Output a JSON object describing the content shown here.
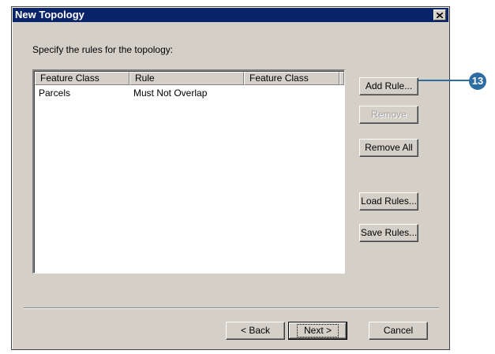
{
  "window": {
    "title": "New Topology"
  },
  "instruction": "Specify the rules for the topology:",
  "rules_list": {
    "columns": [
      "Feature Class",
      "Rule",
      "Feature Class"
    ],
    "rows": [
      {
        "feature_class": "Parcels",
        "rule": "Must Not Overlap",
        "feature_class_2": ""
      }
    ]
  },
  "buttons": {
    "add_rule": "Add Rule...",
    "remove": "Remove",
    "remove_all": "Remove All",
    "load_rules": "Load Rules...",
    "save_rules": "Save Rules..."
  },
  "footer": {
    "back": "< Back",
    "next": "Next >",
    "cancel": "Cancel"
  },
  "callout": {
    "number": "13",
    "color": "#2e6da4"
  },
  "icons": {
    "close": "close-icon"
  }
}
